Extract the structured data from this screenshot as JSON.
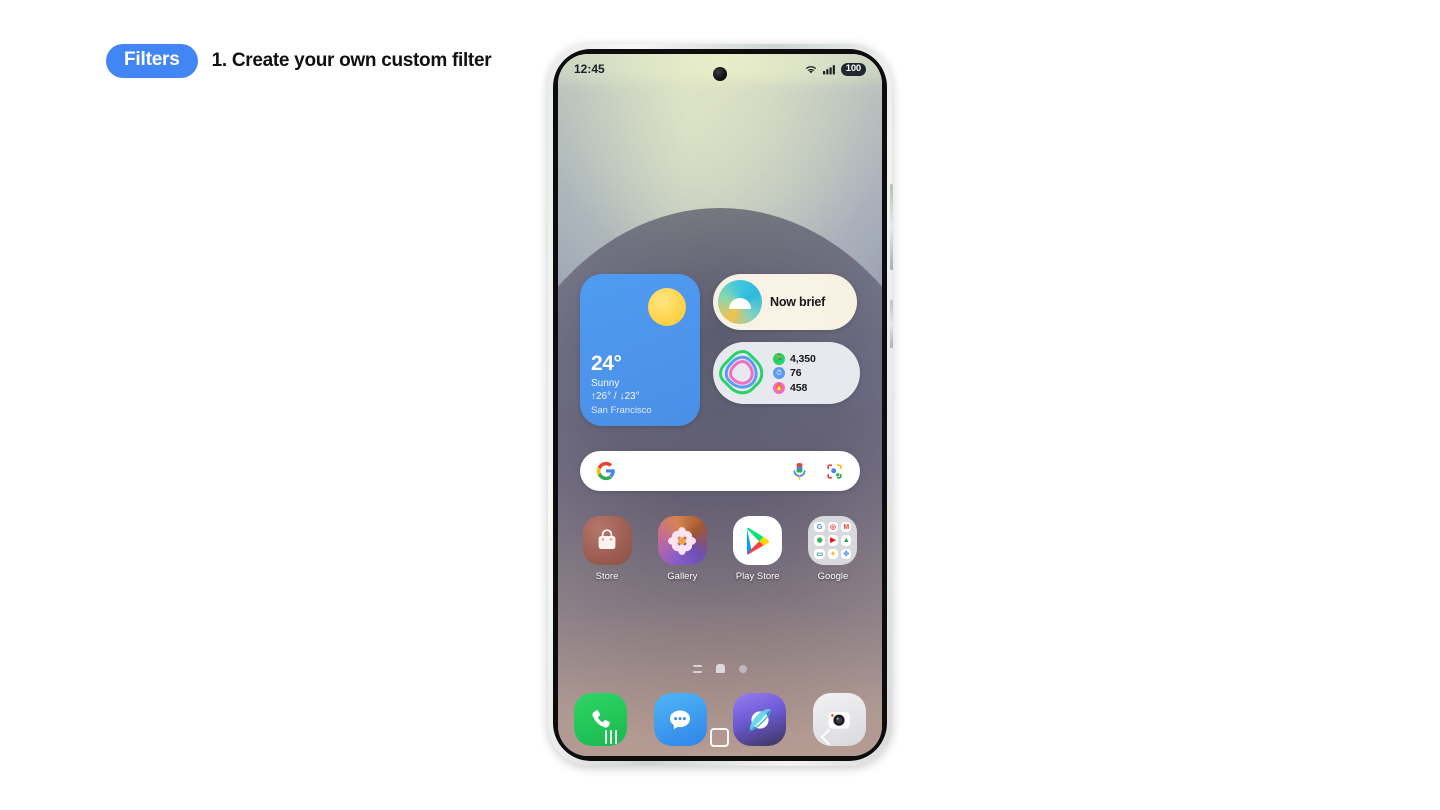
{
  "header": {
    "badge": "Filters",
    "title": "1. Create your own custom filter",
    "badge_color": "#4285f4"
  },
  "phone": {
    "statusbar": {
      "time": "12:45",
      "wifi_icon": "wifi-icon",
      "signal_icon": "signal-bars-icon",
      "battery": "100"
    },
    "widgets": {
      "weather": {
        "temperature": "24°",
        "condition": "Sunny",
        "high_low": "↑26° / ↓23°",
        "city": "San Francisco",
        "icon": "sun-icon",
        "bg_color": "#4d95ed"
      },
      "now_brief": {
        "label": "Now brief",
        "icon": "now-brief-icon"
      },
      "health": {
        "icon": "activity-rings-icon",
        "stats": [
          {
            "icon": "steps-icon",
            "glyph": "🏃",
            "value": "4,350",
            "color": "#25d366"
          },
          {
            "icon": "active-time-icon",
            "glyph": "⏱",
            "value": "76",
            "color": "#5b9bf5"
          },
          {
            "icon": "calories-icon",
            "glyph": "🔥",
            "value": "458",
            "color": "#f06ec0"
          }
        ]
      }
    },
    "search": {
      "google_icon": "google-g-icon",
      "mic_icon": "microphone-icon",
      "lens_icon": "google-lens-icon",
      "placeholder": ""
    },
    "apps": [
      {
        "label": "Store",
        "icon": "store-icon"
      },
      {
        "label": "Gallery",
        "icon": "gallery-icon"
      },
      {
        "label": "Play Store",
        "icon": "play-store-icon"
      },
      {
        "label": "Google",
        "icon": "google-folder-icon"
      }
    ],
    "google_folder_apps": [
      {
        "name": "google-search-icon",
        "glyph": "G",
        "color": "#4285f4"
      },
      {
        "name": "chrome-icon",
        "glyph": "◎",
        "color": "#ea4335"
      },
      {
        "name": "gmail-icon",
        "glyph": "M",
        "color": "#ea4335"
      },
      {
        "name": "maps-icon",
        "glyph": "◉",
        "color": "#34a853"
      },
      {
        "name": "youtube-icon",
        "glyph": "▶",
        "color": "#ff0000"
      },
      {
        "name": "drive-icon",
        "glyph": "▲",
        "color": "#0f9d58"
      },
      {
        "name": "meet-icon",
        "glyph": "▭",
        "color": "#00897b"
      },
      {
        "name": "photos-icon",
        "glyph": "✦",
        "color": "#fbbc04"
      },
      {
        "name": "play-games-icon",
        "glyph": "✜",
        "color": "#4285f4"
      }
    ],
    "page_indicators": [
      {
        "name": "page-indicator-list",
        "type": "lines"
      },
      {
        "name": "page-indicator-home",
        "type": "home"
      },
      {
        "name": "page-indicator-dot",
        "type": "dot"
      }
    ],
    "dock": [
      {
        "label": "Phone",
        "icon": "phone-icon"
      },
      {
        "label": "Messages",
        "icon": "messages-icon"
      },
      {
        "label": "Internet",
        "icon": "internet-icon"
      },
      {
        "label": "Camera",
        "icon": "camera-icon"
      }
    ],
    "navbar": [
      {
        "label": "Recents",
        "icon": "recents-icon"
      },
      {
        "label": "Home",
        "icon": "home-icon"
      },
      {
        "label": "Back",
        "icon": "back-icon"
      }
    ]
  }
}
